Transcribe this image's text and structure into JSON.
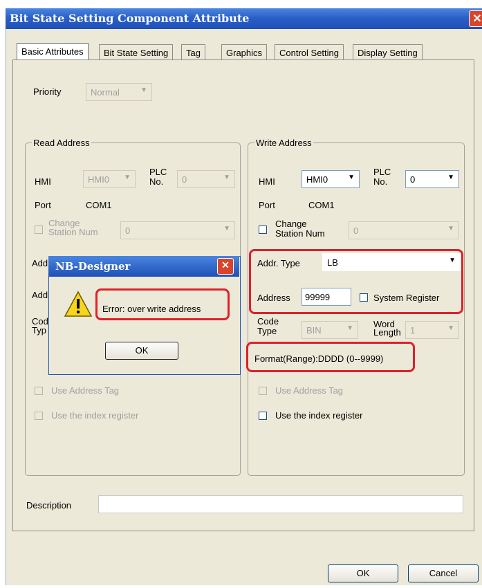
{
  "window": {
    "title": "Bit State Setting Component Attribute",
    "close": "✕"
  },
  "tabs": [
    "Basic Attributes",
    "Bit State Setting",
    "Tag",
    "Graphics",
    "Control Setting",
    "Display Setting"
  ],
  "priority": {
    "label": "Priority",
    "value": "Normal"
  },
  "read": {
    "group": "Read Address",
    "hmi_label": "HMI",
    "hmi_value": "HMI0",
    "plc_label_1": "PLC",
    "plc_label_2": "No.",
    "plc_value": "0",
    "port_label": "Port",
    "port_value": "COM1",
    "change_1": "Change",
    "change_2": "Station Num",
    "change_value": "0",
    "addr_partial": "Add",
    "addr2_partial": "Add",
    "code_partial_1": "Cod",
    "code_partial_2": "Typ",
    "use_tag": "Use Address Tag",
    "use_index": "Use the index register"
  },
  "write": {
    "group": "Write Address",
    "hmi_label": "HMI",
    "hmi_value": "HMI0",
    "plc_label_1": "PLC",
    "plc_label_2": "No.",
    "plc_value": "0",
    "port_label": "Port",
    "port_value": "COM1",
    "change_1": "Change",
    "change_2": "Station Num",
    "change_value": "0",
    "addr_type_label": "Addr. Type",
    "addr_type_value": "LB",
    "address_label": "Address",
    "address_value": "99999",
    "system_register": "System Register",
    "code_label_1": "Code",
    "code_label_2": "Type",
    "code_value": "BIN",
    "word_label_1": "Word",
    "word_label_2": "Length",
    "word_value": "1",
    "format": "Format(Range):DDDD (0--9999)",
    "use_tag": "Use Address Tag",
    "use_index": "Use the index register"
  },
  "description_label": "Description",
  "dialog": {
    "title": "NB-Designer",
    "message": "Error: over write address",
    "ok": "OK",
    "close": "✕"
  },
  "buttons": {
    "ok": "OK",
    "cancel": "Cancel"
  }
}
